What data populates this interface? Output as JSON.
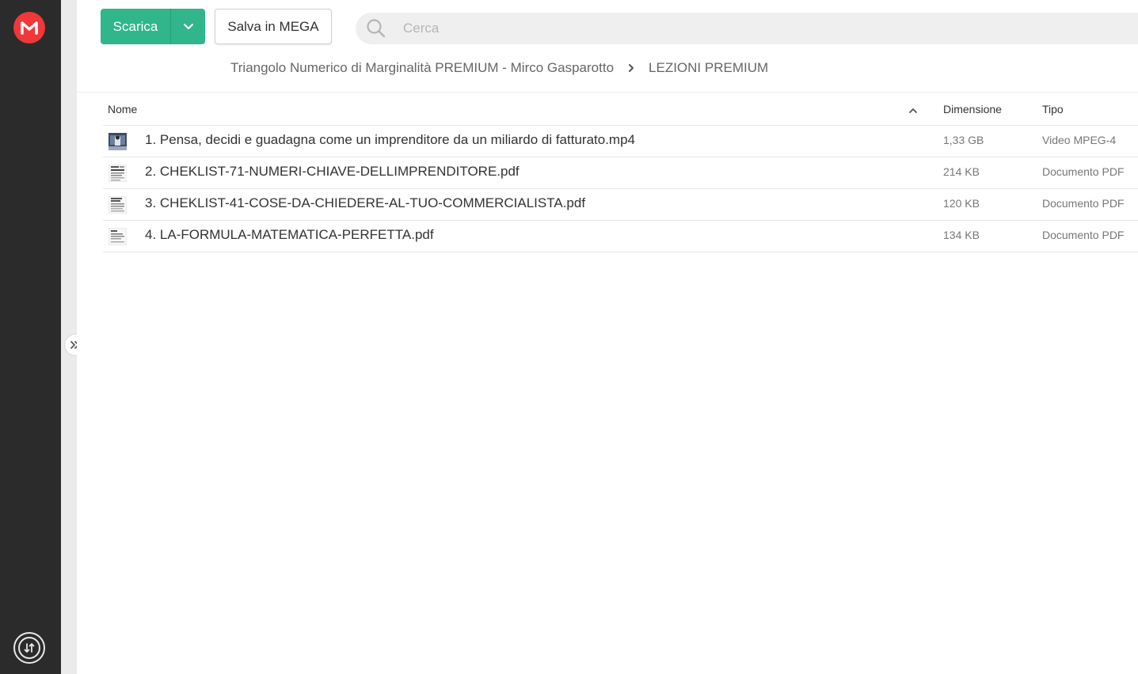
{
  "colors": {
    "brand": "#f0373a",
    "download": "#31b58b",
    "sidebar": "#2b2b2b"
  },
  "toolbar": {
    "download_label": "Scarica",
    "save_label": "Salva in MEGA"
  },
  "search": {
    "placeholder": "Cerca",
    "value": ""
  },
  "breadcrumb": {
    "parent": "Triangolo Numerico di Marginalità PREMIUM - Mirco Gasparotto",
    "current": "LEZIONI PREMIUM"
  },
  "table": {
    "columns": {
      "name": "Nome",
      "size": "Dimensione",
      "type": "Tipo"
    },
    "sort": "ascending",
    "rows": [
      {
        "name": "1. Pensa, decidi e guadagna come un imprenditore da un miliardo di fatturato.mp4",
        "size": "1,33 GB",
        "type": "Video MPEG-4",
        "icon": "video-thumbnail-icon"
      },
      {
        "name": "2. CHEKLIST-71-NUMERI-CHIAVE-DELLIMPRENDITORE.pdf",
        "size": "214 KB",
        "type": "Documento PDF",
        "icon": "pdf-thumbnail-icon"
      },
      {
        "name": "3. CHEKLIST-41-COSE-DA-CHIEDERE-AL-TUO-COMMERCIALISTA.pdf",
        "size": "120 KB",
        "type": "Documento PDF",
        "icon": "pdf-thumbnail-icon"
      },
      {
        "name": "4. LA-FORMULA-MATEMATICA-PERFETTA.pdf",
        "size": "134 KB",
        "type": "Documento PDF",
        "icon": "pdf-thumbnail-icon"
      }
    ]
  }
}
